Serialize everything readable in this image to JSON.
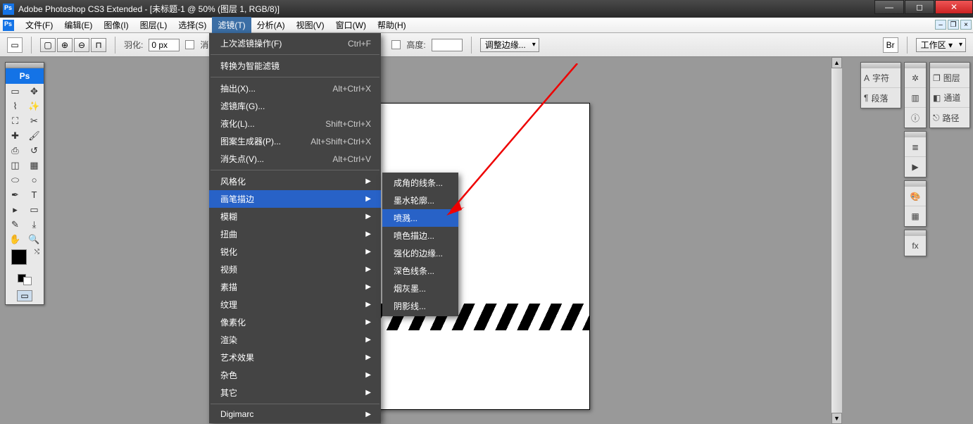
{
  "titlebar": {
    "title": "Adobe Photoshop CS3 Extended - [未标题-1 @ 50% (图层 1, RGB/8)]"
  },
  "menubar": {
    "items": [
      "文件(F)",
      "编辑(E)",
      "图像(I)",
      "图层(L)",
      "选择(S)",
      "滤镜(T)",
      "分析(A)",
      "视图(V)",
      "窗口(W)",
      "帮助(H)"
    ]
  },
  "opt": {
    "feather_label": "羽化:",
    "feather_value": "0 px",
    "antialias": "消除锯",
    "height": "高度:",
    "refine": "调整边缘...",
    "workspace": "工作区 ▾"
  },
  "filter_menu": {
    "last": {
      "label": "上次滤镜操作(F)",
      "shortcut": "Ctrl+F"
    },
    "smart": "转换为智能滤镜",
    "extract": {
      "label": "抽出(X)...",
      "shortcut": "Alt+Ctrl+X"
    },
    "gallery": "滤镜库(G)...",
    "liquify": {
      "label": "液化(L)...",
      "shortcut": "Shift+Ctrl+X"
    },
    "pattern": {
      "label": "图案生成器(P)...",
      "shortcut": "Alt+Shift+Ctrl+X"
    },
    "vanish": {
      "label": "消失点(V)...",
      "shortcut": "Alt+Ctrl+V"
    },
    "cats": [
      "风格化",
      "画笔描边",
      "模糊",
      "扭曲",
      "锐化",
      "视频",
      "素描",
      "纹理",
      "像素化",
      "渲染",
      "艺术效果",
      "杂色",
      "其它"
    ],
    "digimarc": "Digimarc"
  },
  "submenu": {
    "items": [
      "成角的线条...",
      "墨水轮廓...",
      "喷溅...",
      "喷色描边...",
      "强化的边缘...",
      "深色线条...",
      "烟灰墨...",
      "阴影线..."
    ]
  },
  "right": {
    "char": "字符",
    "para": "段落",
    "layer": "图层",
    "channel": "通道",
    "path": "路径"
  }
}
